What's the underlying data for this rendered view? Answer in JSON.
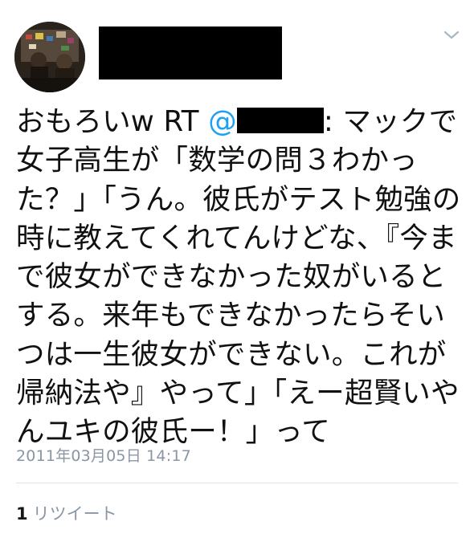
{
  "tweet": {
    "text_prefix": "おもろいw RT ",
    "mention_at": "@",
    "text_rest": ": マックで女子高生が「数学の問３わかった？」「うん。彼氏がテスト勉強の時に教えてくれてんけどな、『今まで彼女ができなかった奴がいるとする。来年もできなかったらそいつは一生彼女ができない。これが帰納法や』やって」「えー超賢いやんユキの彼氏ー！」って",
    "timestamp": "2011年03月05日 14:17",
    "retweet_count": "1",
    "retweet_label": "リツイート"
  },
  "icons": {
    "menu": "chevron-down-icon"
  },
  "colors": {
    "mention": "#1da1f2",
    "meta_text": "#8a96a3",
    "divider": "#dfe4e8"
  }
}
